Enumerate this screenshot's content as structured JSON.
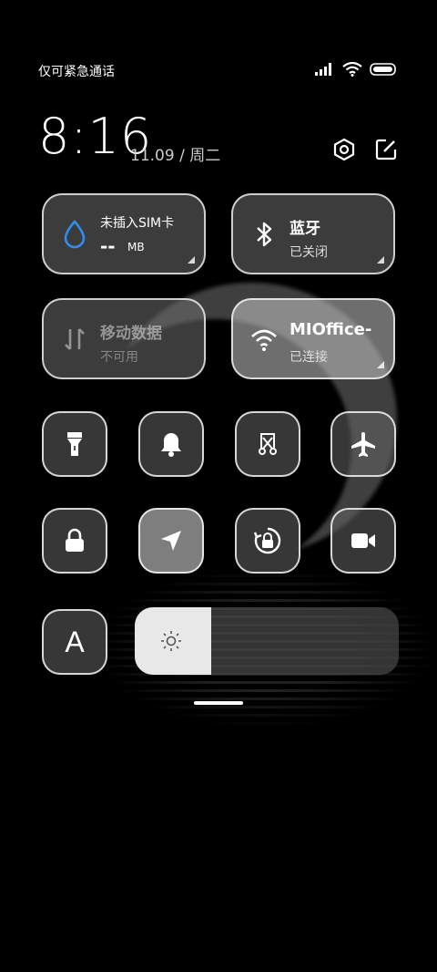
{
  "status_bar": {
    "carrier_text": "仅可紧急通话",
    "icons": [
      "signal-icon",
      "wifi-icon",
      "battery-icon"
    ]
  },
  "header": {
    "time": "8:16",
    "date": "11.09 / 周二",
    "buttons": [
      "settings-icon",
      "edit-icon"
    ]
  },
  "tiles": {
    "data_usage": {
      "title": "未插入SIM卡",
      "value": "--",
      "unit": "MB",
      "icon": "water-drop-icon",
      "accent": "#2f8ef0"
    },
    "bluetooth": {
      "title": "蓝牙",
      "status": "已关闭",
      "icon": "bluetooth-icon"
    },
    "mobile_data": {
      "title": "移动数据",
      "status": "不可用",
      "icon": "data-arrows-icon"
    },
    "wifi": {
      "title": "MIOffice-",
      "status": "已连接",
      "icon": "wifi-icon"
    }
  },
  "toggles_row1": [
    "flashlight-icon",
    "bell-icon",
    "screenshot-icon",
    "airplane-icon"
  ],
  "toggles_row2": [
    "lock-icon",
    "location-icon",
    "rotation-lock-icon",
    "video-icon"
  ],
  "font_toggle": {
    "label": "A"
  },
  "brightness": {
    "level": 0.29,
    "icon": "sun-icon"
  }
}
